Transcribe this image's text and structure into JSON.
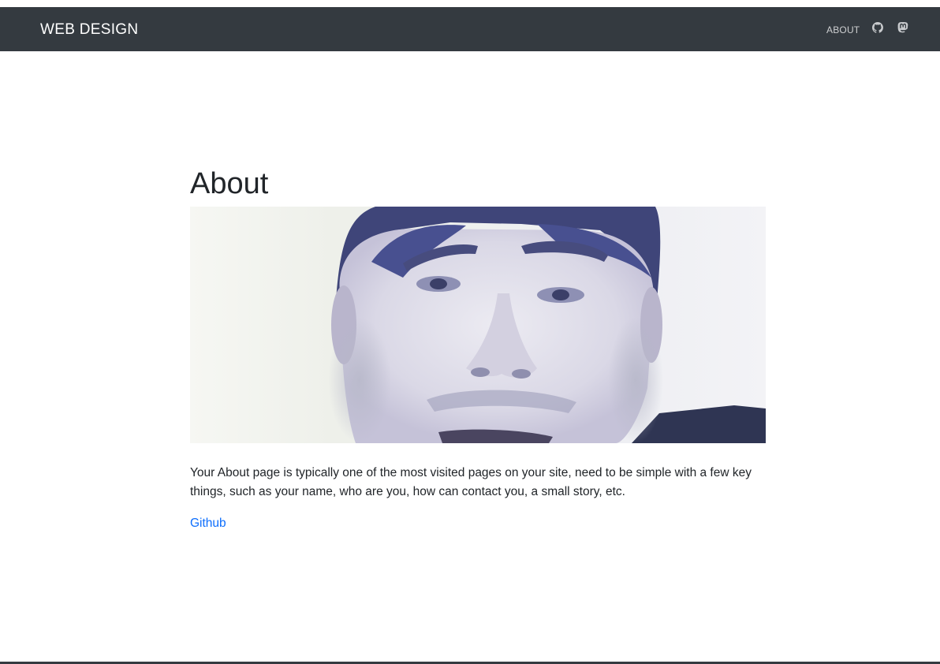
{
  "navbar": {
    "brand": "WEB DESIGN",
    "links": [
      {
        "label": "ABOUT"
      }
    ],
    "icons": [
      "github-icon",
      "mastodon-icon"
    ],
    "background_color": "#343a40"
  },
  "main": {
    "title": "About",
    "photo_icon": "profile-photo",
    "intro": "Your About page is typically one of the most visited pages on your site, need to be simple with a few key things, such as your name, who are you, how can contact you, a small story, etc.",
    "link_label": "Github",
    "link_color": "#0d6efd"
  }
}
